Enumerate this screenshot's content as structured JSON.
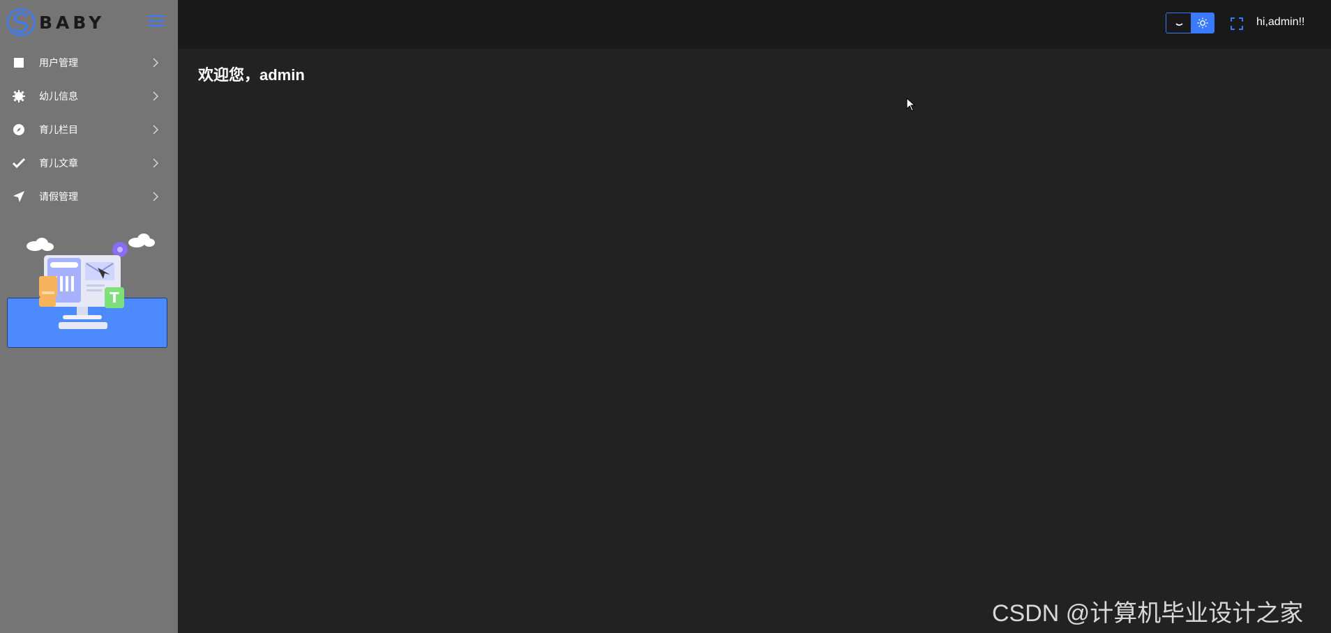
{
  "brand": {
    "name": "BABY",
    "accent": "#3a7afe"
  },
  "sidebar": {
    "items": [
      {
        "label": "用户管理",
        "icon": "square-icon"
      },
      {
        "label": "幼儿信息",
        "icon": "gear-icon"
      },
      {
        "label": "育儿栏目",
        "icon": "compass-icon"
      },
      {
        "label": "育儿文章",
        "icon": "check-icon"
      },
      {
        "label": "请假管理",
        "icon": "send-icon"
      }
    ]
  },
  "header": {
    "greeting": "hi,admin!!"
  },
  "main": {
    "welcome": "欢迎您，admin"
  },
  "watermark": "CSDN @计算机毕业设计之家"
}
